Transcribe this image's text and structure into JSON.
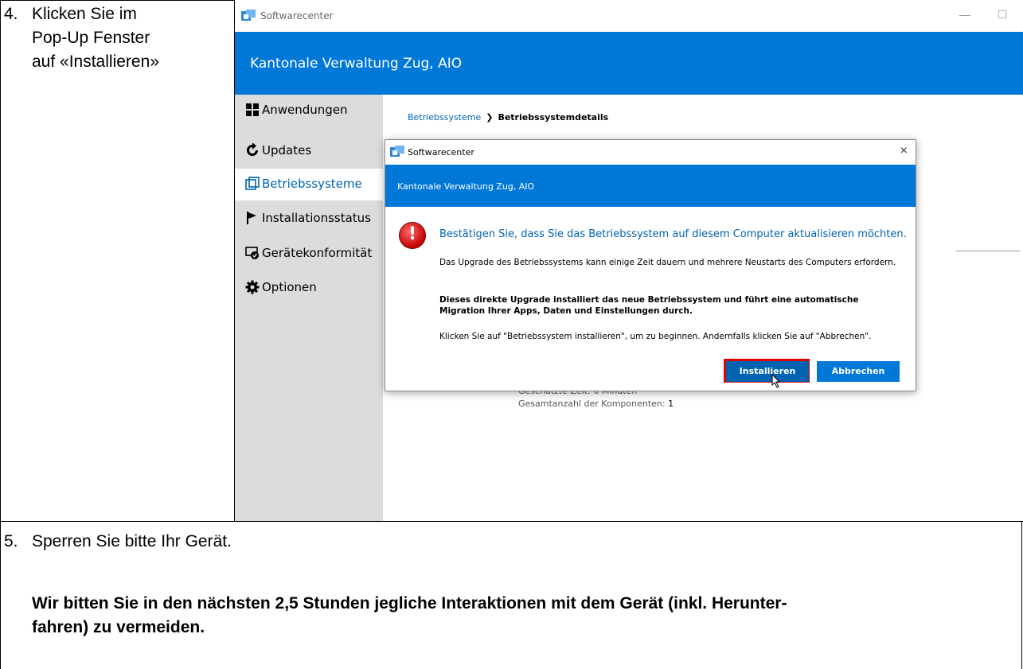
{
  "document": {
    "step4": {
      "number": "4.",
      "lines": [
        "Klicken Sie im",
        "Pop-Up Fenster",
        "auf «Installieren»"
      ]
    },
    "step5": {
      "number": "5.",
      "text": "Sperren Sie bitte Ihr Gerät.",
      "bold_lines": [
        "Wir bitten Sie in den nächsten 2,5 Stunden jegliche Interaktionen mit dem Gerät (inkl. Herunter-",
        "fahren) zu vermeiden."
      ]
    }
  },
  "app": {
    "window_title": "Softwarecenter",
    "window_controls": {
      "minimize": "—",
      "maximize": "☐"
    },
    "header_title": "Kantonale Verwaltung Zug, AIO",
    "sidebar": {
      "items": [
        {
          "label": "Anwendungen",
          "icon": "grid-icon"
        },
        {
          "label": "Updates",
          "icon": "refresh-icon"
        },
        {
          "label": "Betriebssysteme",
          "icon": "os-icon",
          "active": true
        },
        {
          "label": "Installationsstatus",
          "icon": "flag-icon"
        },
        {
          "label": "Gerätekonformität",
          "icon": "device-check-icon"
        },
        {
          "label": "Optionen",
          "icon": "gear-icon"
        }
      ]
    },
    "breadcrumb": {
      "link": "Betriebssysteme",
      "separator": "❯",
      "current": "Betriebssystemdetails"
    },
    "details": {
      "time_line": "Geschätzte Zeit: 0 Minuten",
      "components_label": "Gesamtanzahl der Komponenten:",
      "components_value": "1"
    }
  },
  "dialog": {
    "title": "Softwarecenter",
    "close": "×",
    "band_text": "Kantonale Verwaltung Zug, AIO",
    "icon": "error-icon",
    "heading": "Bestätigen Sie, dass Sie das Betriebssystem auf diesem Computer aktualisieren möchten.",
    "paragraph1": "Das Upgrade des Betriebssystems kann einige Zeit dauern und mehrere Neustarts des Computers erfordern.",
    "paragraph2": "Dieses direkte Upgrade installiert das neue Betriebssystem und führt eine automatische Migration Ihrer Apps, Daten und Einstellungen durch.",
    "paragraph3": "Klicken Sie auf \"Betriebssystem installieren\", um zu beginnen. Andernfalls klicken Sie auf \"Abbrechen\".",
    "install_label": "Installieren",
    "cancel_label": "Abbrechen",
    "highlight_color": "#e00000"
  },
  "colors": {
    "accent": "#0078d7",
    "link": "#0063b1",
    "sidebar_bg": "#dcdcdc"
  }
}
